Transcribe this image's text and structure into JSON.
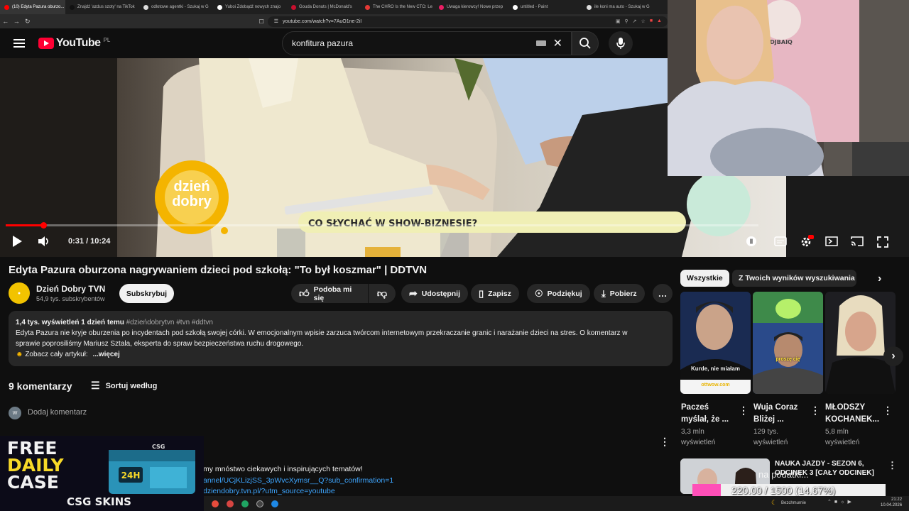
{
  "browser": {
    "tabs": [
      {
        "label": "(10) Edyta Pazura oburzo...",
        "color": "#ff0000",
        "active": true
      },
      {
        "label": "Znajdź 'azdus szoty' na TikTok",
        "color": "#111111"
      },
      {
        "label": "odlotowe agentki - Szukaj w G",
        "color": "#dddddd"
      },
      {
        "label": "Yuboi Zdobądź nowych znajo",
        "color": "#ffffff"
      },
      {
        "label": "Gouda Donuts | McDonald's",
        "color": "#c8102e"
      },
      {
        "label": "The CHRO Is the New CTO: Le",
        "color": "#e53935"
      },
      {
        "label": "Uwaga kierowcy! Nowe przep",
        "color": "#e91e63"
      },
      {
        "label": "untitled - Paint",
        "color": "#ffffff"
      },
      {
        "label": "ile koni ma auto - Szukaj w G",
        "color": "#dddddd"
      }
    ],
    "url": "youtube.com/watch?v=7AuO1ne-2iI"
  },
  "header": {
    "logo_text": "YouTube",
    "country": "PL",
    "search_value": "konfitura pazura"
  },
  "player": {
    "time": "0:31 / 10:24",
    "progress_fraction": 0.05,
    "lower_third": "CO SŁYCHAĆ W SHOW-BIZNESIE?",
    "logo_line1": "dzień",
    "logo_line2": "dobry",
    "webcam_brand": "DJBAIQ"
  },
  "video": {
    "title": "Edyta Pazura oburzona nagrywaniem dzieci pod szkołą: \"To był koszmar\" | DDTVN",
    "channel": "Dzień Dobry TVN",
    "subs": "54,9 tys. subskrybentów",
    "subscribe": "Subskrybuj",
    "like": "Podoba mi się",
    "share": "Udostępnij",
    "save": "Zapisz",
    "thanks": "Podziękuj",
    "download": "Pobierz"
  },
  "description": {
    "meta": "1,4 tys. wyświetleń  1 dzień temu",
    "tags": "#dzieńdobrytvn #tvn #ddtvn",
    "line1": "Edyta Pazura nie kryje oburzenia po incydentach pod szkołą swojej córki. W emocjonalnym wpisie zarzuca twórcom internetowym przekraczanie granic i narażanie dzieci na stres. O komentarz w",
    "line2": "sprawie poprosiliśmy Mariusz Sztala, eksperta do spraw bezpieczeństwa ruchu drogowego.",
    "line3": "Zobacz cały artykuł:",
    "more": "...więcej"
  },
  "comments": {
    "count": "9 komentarzy",
    "sort": "Sortuj według",
    "add_placeholder": "Dodaj komentarz",
    "avatar_letter": "W",
    "pinned_line1": "my mnóstwo ciekawych i inspirujących tematów!",
    "pinned_line2": "annel/UCjKLizjSS_3pWvcXymsr__Q?sub_confirmation=1",
    "pinned_line3": "dziendobry.tvn.pl/?utm_source=youtube"
  },
  "ad": {
    "line1": "FREE",
    "line2": "DAILY",
    "line3": "CASE",
    "badge": "24H",
    "brand": "CSG SKINS",
    "small": "CSG"
  },
  "sidebar": {
    "chips": [
      "Wszystkie",
      "Z Twoich wyników wyszukiwania"
    ],
    "shorts": [
      {
        "title1": "Pacześ",
        "title2": "myślał, że ...",
        "views1": "3,3 mln",
        "views2": "wyświetleń",
        "caption": "Kurde, nie miałam",
        "sub": "ottwow.com"
      },
      {
        "title1": "Wuja Coraz",
        "title2": "Bliżej ...",
        "views1": "129 tys.",
        "views2": "wyświetleń",
        "caption": "proszę cię"
      },
      {
        "title1": "MŁODSZY",
        "title2": "KOCHANEK...",
        "views1": "5,8 mln",
        "views2": "wyświetleń"
      }
    ],
    "list_title1": "NAUKA JAZDY - SEZON 6,",
    "list_title2": "ODCINEK 3 [CAŁY ODCINEK]",
    "list_overlay": "na podatki..."
  },
  "goal": {
    "text": "220.00 / 1500 (14.67%)",
    "fraction": 0.1467
  },
  "taskbar": {
    "weather": "Bezchmurnie",
    "time": "21:22",
    "date": "10.04.2026"
  }
}
